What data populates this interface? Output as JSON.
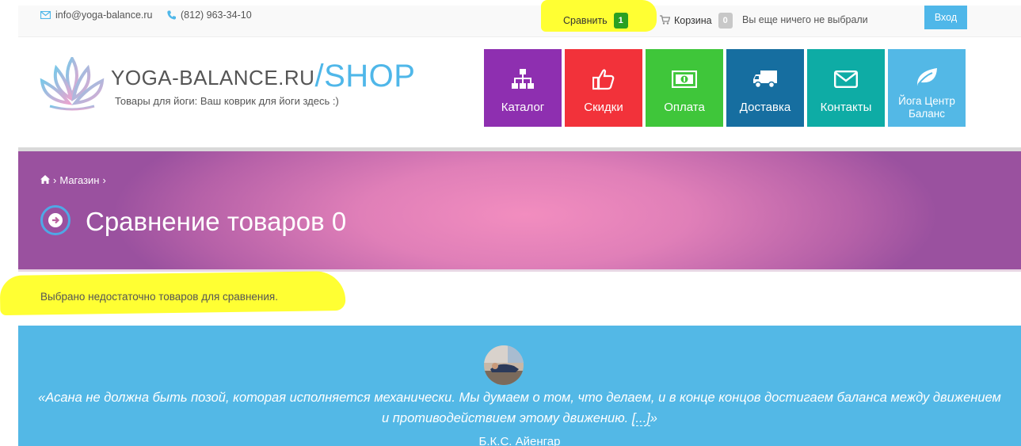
{
  "topbar": {
    "email": "info@yoga-balance.ru",
    "phone": "(812) 963-34-10",
    "compare_label": "Сравнить",
    "compare_count": "1",
    "cart_label": "Корзина",
    "cart_count": "0",
    "cart_empty_text": "Вы еще ничего не выбрали",
    "login_label": "Вход"
  },
  "header": {
    "logo_main": "YOGA-BALANCE.RU",
    "logo_shop": "/SHOP",
    "tagline": "Товары для йоги:  Ваш коврик для йоги здесь :)"
  },
  "nav": {
    "items": [
      {
        "label": "Каталог",
        "icon": "sitemap-icon",
        "color": "#8e2fb0"
      },
      {
        "label": "Скидки",
        "icon": "thumbs-up-icon",
        "color": "#f2323a"
      },
      {
        "label": "Оплата",
        "icon": "money-icon",
        "color": "#3fc63a"
      },
      {
        "label": "Доставка",
        "icon": "truck-icon",
        "color": "#166ea0"
      },
      {
        "label": "Контакты",
        "icon": "envelope-icon",
        "color": "#0eaca5"
      },
      {
        "label": "Йога Центр Баланс",
        "icon": "leaf-icon",
        "color": "#53b8e6"
      }
    ]
  },
  "hero": {
    "breadcrumb_shop": "Магазин",
    "title": "Сравнение товаров 0"
  },
  "notice": "Выбрано недостаточно товаров для сравнения.",
  "quote": {
    "text": "«Асана не должна быть позой, которая исполняется механически. Мы думаем о том, что делаем, и в конце концов достигаем баланса между движением и противодействием этому движению.",
    "more": "[...]",
    "closing": "»",
    "author": "Б.К.С. Айенгар"
  },
  "colors": {
    "accent": "#4fb7e9",
    "highlight": "#ffff33",
    "badge_green": "#2aa022"
  }
}
